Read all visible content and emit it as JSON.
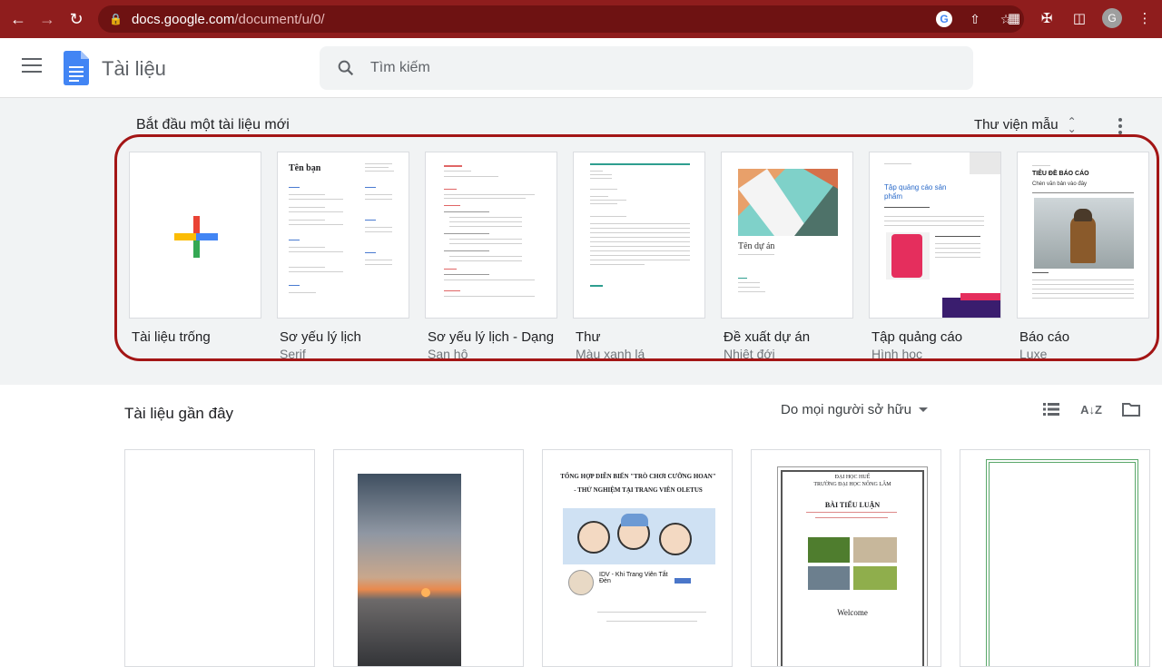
{
  "browser": {
    "url_host": "docs.google.com",
    "url_path": "/document/u/0/",
    "profile_initial": "G"
  },
  "header": {
    "title": "Tài liệu",
    "search_placeholder": "Tìm kiếm"
  },
  "gallery": {
    "title": "Bắt đầu một tài liệu mới",
    "library_label": "Thư viện mẫu",
    "highlight_color": "#a31515",
    "templates": [
      {
        "name": "Tài liệu trống",
        "sub": ""
      },
      {
        "name": "Sơ yếu lý lịch",
        "sub": "Serif",
        "thumb_title": "Tên bạn"
      },
      {
        "name": "Sơ yếu lý lịch - Dạng",
        "sub": "San hô"
      },
      {
        "name": "Thư",
        "sub": "Màu xanh lá"
      },
      {
        "name": "Đề xuất dự án",
        "sub": "Nhiệt đới",
        "thumb_title": "Tên dự án"
      },
      {
        "name": "Tập quảng cáo",
        "sub": "Hình học",
        "thumb_title": "Tập quảng cáo sản phẩm"
      },
      {
        "name": "Báo cáo",
        "sub": "Luxe",
        "thumb_title": "TIÊU ĐỀ BÁO CÁO",
        "thumb_subtitle": "Chèn văn bản vào đây"
      }
    ]
  },
  "recent": {
    "title": "Tài liệu gần đây",
    "owner_filter": "Do mọi người sở hữu",
    "docs": [
      {
        "title_text": ""
      },
      {
        "title_text": ""
      },
      {
        "title_text": "TỔNG HỢP DIỄN BIẾN \"TRÒ CHƠI CƯỠNG HOAN\"",
        "sub_text": "- THỬ NGHIỆM TẠI TRANG VIÊN OLETUS",
        "page_name": "IDV - Khi Trang Viên Tắt Đèn"
      },
      {
        "title_text": "ĐẠI HỌC HUẾ",
        "sub_text": "TRƯỜNG ĐẠI HỌC NÔNG LÂM",
        "heading": "BÀI TIỂU LUẬN",
        "footer": "Welcome"
      },
      {
        "title_text": ""
      }
    ]
  }
}
